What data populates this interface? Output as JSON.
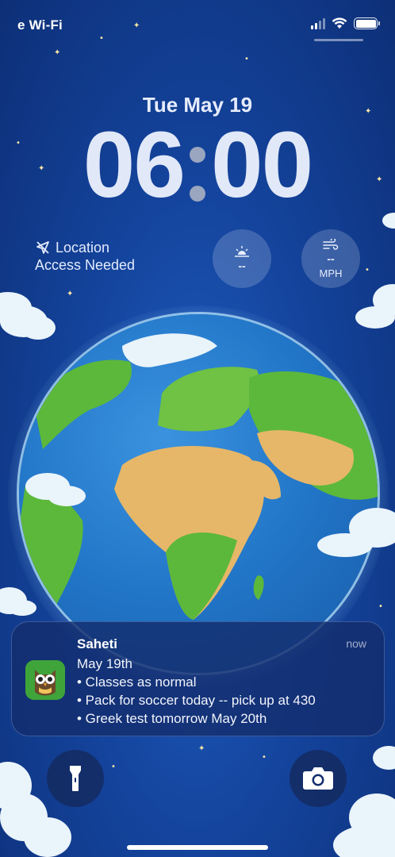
{
  "status_bar": {
    "carrier": "e Wi-Fi",
    "icons": [
      "cellular-signal-icon",
      "wifi-icon",
      "battery-icon"
    ]
  },
  "lock_screen": {
    "date": "Tue May 19",
    "time_hours": "06",
    "time_minutes": "00"
  },
  "widgets": {
    "location_line1": "Location",
    "location_line2": "Access Needed",
    "sunrise_value": "--",
    "wind_value": "--",
    "wind_unit": "MPH"
  },
  "notification": {
    "app": "Saheti",
    "time": "now",
    "lines": [
      "May 19th",
      "• Classes as normal",
      "• Pack for soccer today -- pick up at 430",
      "• Greek test tomorrow May 20th"
    ]
  },
  "quick_actions": {
    "left_icon": "flashlight-icon",
    "right_icon": "camera-icon"
  },
  "colors": {
    "background": "#14449d",
    "ocean": "#2175c7",
    "land_green": "#5cb83a",
    "land_desert": "#e6b769",
    "notification_bg": "#142d6e",
    "app_icon_bg": "#3fa43a"
  }
}
